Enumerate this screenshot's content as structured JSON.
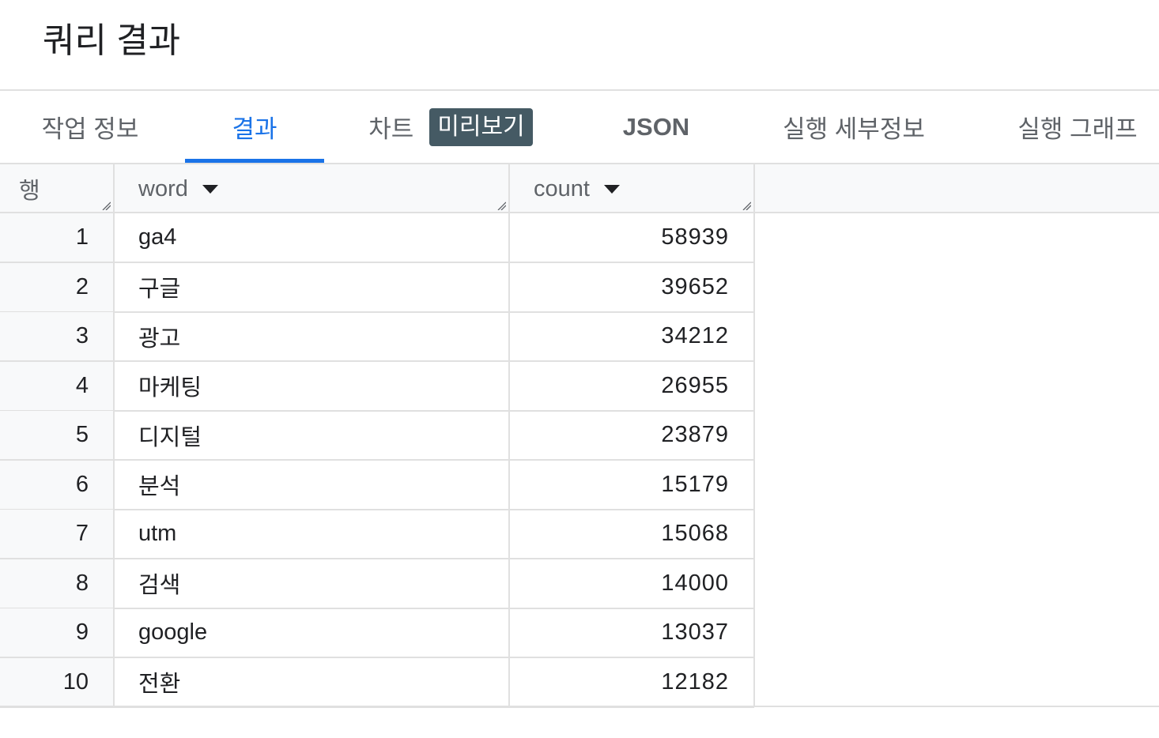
{
  "header": {
    "title": "쿼리 결과"
  },
  "tabs": [
    {
      "label": "작업 정보",
      "active": false
    },
    {
      "label": "결과",
      "active": true
    },
    {
      "label": "차트",
      "badge": "미리보기",
      "active": false
    },
    {
      "label": "JSON",
      "active": false
    },
    {
      "label": "실행 세부정보",
      "active": false
    },
    {
      "label": "실행 그래프",
      "active": false
    }
  ],
  "colors": {
    "accent": "#1a73e8",
    "badge_bg": "#455a64",
    "header_bg": "#f8f9fa",
    "border": "#e0e0e0"
  },
  "table": {
    "columns": [
      {
        "label": "행"
      },
      {
        "label": "word",
        "menu_icon": "caret-down-icon"
      },
      {
        "label": "count",
        "menu_icon": "caret-down-icon"
      }
    ],
    "rows": [
      {
        "row": "1",
        "word": "ga4",
        "count": "58939"
      },
      {
        "row": "2",
        "word": "구글",
        "count": "39652"
      },
      {
        "row": "3",
        "word": "광고",
        "count": "34212"
      },
      {
        "row": "4",
        "word": "마케팅",
        "count": "26955"
      },
      {
        "row": "5",
        "word": "디지털",
        "count": "23879"
      },
      {
        "row": "6",
        "word": "분석",
        "count": "15179"
      },
      {
        "row": "7",
        "word": "utm",
        "count": "15068"
      },
      {
        "row": "8",
        "word": "검색",
        "count": "14000"
      },
      {
        "row": "9",
        "word": "google",
        "count": "13037"
      },
      {
        "row": "10",
        "word": "전환",
        "count": "12182"
      }
    ]
  }
}
